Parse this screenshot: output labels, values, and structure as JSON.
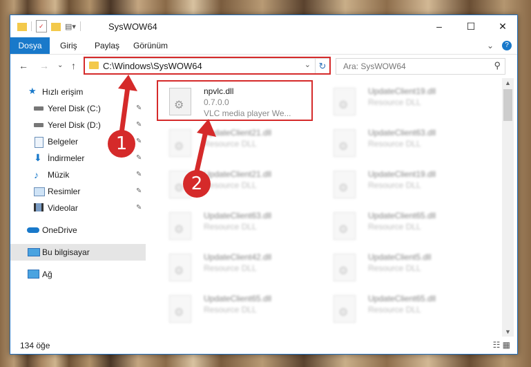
{
  "window": {
    "title": "SysWOW64"
  },
  "window_controls": {
    "minimize": "–",
    "maximize": "☐",
    "close": "✕"
  },
  "ribbon": {
    "tabs": [
      "Dosya",
      "Giriş",
      "Paylaş",
      "Görünüm"
    ],
    "expand_glyph": "⌄",
    "help_glyph": "?"
  },
  "navigation": {
    "back": "←",
    "forward": "→",
    "recent": "⌄",
    "up": "↑"
  },
  "address_bar": {
    "path": "C:\\Windows\\SysWOW64",
    "dropdown_glyph": "⌄",
    "refresh_glyph": "↻"
  },
  "search": {
    "placeholder": "Ara: SysWOW64",
    "icon": "search-icon"
  },
  "sidebar": {
    "items": [
      {
        "label": "Hızlı erişim",
        "icon": "star-icon",
        "pinned": false
      },
      {
        "label": "Yerel Disk (C:)",
        "icon": "drive-icon",
        "pinned": true
      },
      {
        "label": "Yerel Disk (D:)",
        "icon": "drive-icon",
        "pinned": true
      },
      {
        "label": "Belgeler",
        "icon": "documents-icon",
        "pinned": true
      },
      {
        "label": "İndirmeler",
        "icon": "download-icon",
        "pinned": true
      },
      {
        "label": "Müzik",
        "icon": "music-icon",
        "pinned": true
      },
      {
        "label": "Resimler",
        "icon": "pictures-icon",
        "pinned": true
      },
      {
        "label": "Videolar",
        "icon": "video-icon",
        "pinned": true
      },
      {
        "label": "OneDrive",
        "icon": "cloud-icon",
        "pinned": false
      },
      {
        "label": "Bu bilgisayar",
        "icon": "computer-icon",
        "pinned": false,
        "selected": true
      },
      {
        "label": "Ağ",
        "icon": "network-icon",
        "pinned": false
      }
    ],
    "pin_glyph": "📌"
  },
  "files": {
    "highlighted": {
      "name": "npvlc.dll",
      "version": "0.7.0.0",
      "description": "VLC media player We..."
    },
    "others": [
      {
        "name": "UpdateClient19.dll",
        "type": "Resource DLL"
      },
      {
        "name": "UpdateClient21.dll",
        "type": "Resource DLL"
      },
      {
        "name": "UpdateClient63.dll",
        "type": "Resource DLL"
      },
      {
        "name": "UpdateClient21.dll",
        "type": "Resource DLL"
      },
      {
        "name": "UpdateClient19.dll",
        "type": "Resource DLL"
      },
      {
        "name": "UpdateClient63.dll",
        "type": "Resource DLL"
      },
      {
        "name": "UpdateClient65.dll",
        "type": "Resource DLL"
      },
      {
        "name": "UpdateClient42.dll",
        "type": "Resource DLL"
      },
      {
        "name": "UpdateClient5.dll",
        "type": "Resource DLL"
      },
      {
        "name": "UpdateClient65.dll",
        "type": "Resource DLL"
      },
      {
        "name": "UpdateClient65.dll",
        "type": "Resource DLL"
      }
    ]
  },
  "status": {
    "item_count": "134 öğe"
  },
  "callouts": {
    "one": "1",
    "two": "2"
  },
  "colors": {
    "accent": "#1979ca",
    "highlight": "#d52a2a"
  }
}
